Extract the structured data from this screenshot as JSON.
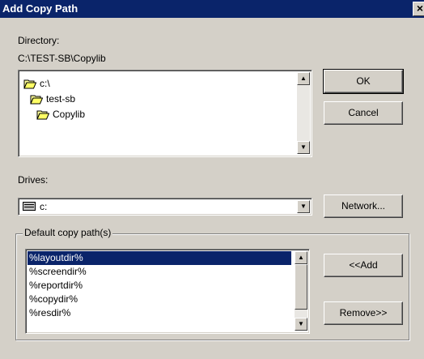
{
  "window": {
    "title": "Add Copy Path",
    "close_glyph": "×"
  },
  "directory": {
    "label": "Directory:",
    "current_path": "C:\\TEST-SB\\Copylib",
    "tree": [
      {
        "label": "c:\\",
        "icon": "open-folder-icon"
      },
      {
        "label": "test-sb",
        "icon": "open-folder-icon"
      },
      {
        "label": "Copylib",
        "icon": "open-folder-icon"
      }
    ]
  },
  "buttons": {
    "ok": "OK",
    "cancel": "Cancel",
    "network": "Network...",
    "add": "<<Add",
    "remove": "Remove>>"
  },
  "drives": {
    "label": "Drives:",
    "selected": "c:"
  },
  "default_paths": {
    "title": "Default copy path(s)",
    "items": [
      "%layoutdir%",
      "%screendir%",
      "%reportdir%",
      "%copydir%",
      "%resdir%"
    ],
    "selected_index": 0
  },
  "colors": {
    "face": "#d4d0c8",
    "title_bar": "#0a246a",
    "selection": "#0a246a"
  }
}
